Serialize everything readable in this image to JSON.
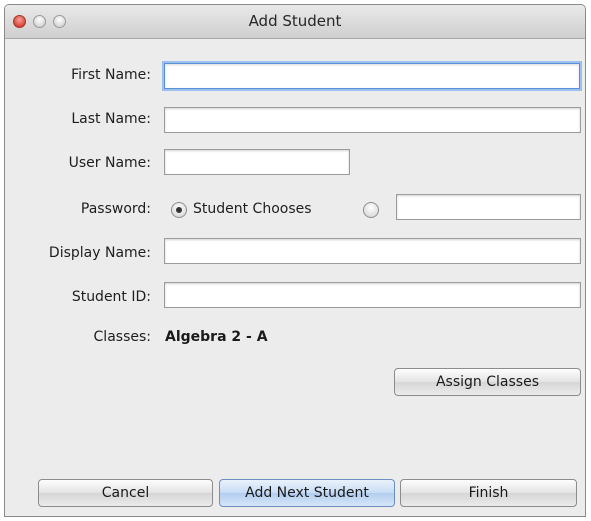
{
  "window": {
    "title": "Add Student"
  },
  "form": {
    "first_name_label": "First Name:",
    "first_name_value": "",
    "last_name_label": "Last Name:",
    "last_name_value": "",
    "user_name_label": "User Name:",
    "user_name_value": "",
    "password_label": "Password:",
    "password_option_student_chooses": "Student Chooses",
    "password_selected": "student_chooses",
    "password_custom_value": "",
    "display_name_label": "Display Name:",
    "display_name_value": "",
    "student_id_label": "Student ID:",
    "student_id_value": "",
    "classes_label": "Classes:",
    "classes_value": "Algebra 2 - A"
  },
  "buttons": {
    "assign_classes": "Assign Classes",
    "cancel": "Cancel",
    "add_next_student": "Add Next Student",
    "finish": "Finish"
  }
}
